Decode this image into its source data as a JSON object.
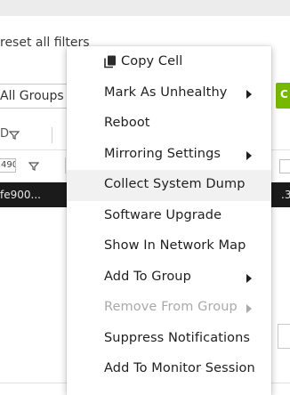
{
  "background": {
    "reset_filters_text": "reset all filters",
    "groups_select_value": "All Groups",
    "green_button_label": "C",
    "header_partial_text": "D",
    "filter_input_value": "490",
    "row_cell_text": "fe900...",
    "row_cell_right_text": ".3"
  },
  "menu": {
    "items": [
      {
        "label": "Copy Cell",
        "icon": "copy-icon",
        "has_submenu": false,
        "disabled": false
      },
      {
        "label": "Mark As Unhealthy",
        "has_submenu": true,
        "disabled": false
      },
      {
        "label": "Reboot",
        "has_submenu": false,
        "disabled": false
      },
      {
        "label": "Mirroring Settings",
        "has_submenu": true,
        "disabled": false
      },
      {
        "label": "Collect System Dump",
        "has_submenu": false,
        "disabled": false,
        "highlighted": true
      },
      {
        "label": "Software Upgrade",
        "has_submenu": false,
        "disabled": false
      },
      {
        "label": "Show In Network Map",
        "has_submenu": false,
        "disabled": false
      },
      {
        "label": "Add To Group",
        "has_submenu": true,
        "disabled": false
      },
      {
        "label": "Remove From Group",
        "has_submenu": true,
        "disabled": true
      },
      {
        "label": "Suppress Notifications",
        "has_submenu": false,
        "disabled": false
      },
      {
        "label": "Add To Monitor Session",
        "has_submenu": false,
        "disabled": false
      }
    ]
  },
  "colors": {
    "accent_green": "#76b900",
    "row_dark": "#1b1b1b",
    "hover_bg": "#f1f1f1",
    "disabled_text": "#a9a9a9"
  }
}
